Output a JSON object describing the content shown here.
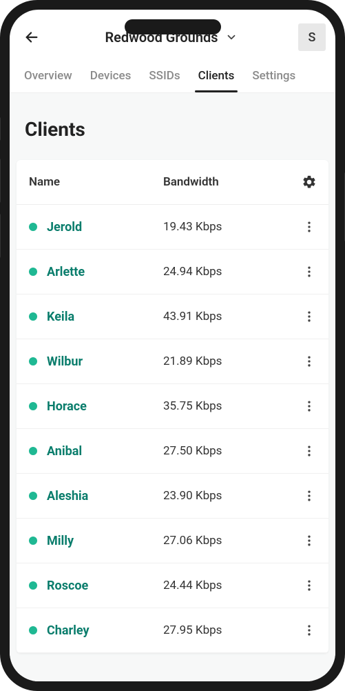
{
  "header": {
    "site_name": "Redwood Grounds",
    "avatar_initial": "S"
  },
  "tabs": [
    {
      "label": "Overview",
      "active": false
    },
    {
      "label": "Devices",
      "active": false
    },
    {
      "label": "SSIDs",
      "active": false
    },
    {
      "label": "Clients",
      "active": true
    },
    {
      "label": "Settings",
      "active": false
    }
  ],
  "page": {
    "title": "Clients"
  },
  "table": {
    "columns": {
      "name": "Name",
      "bandwidth": "Bandwidth"
    },
    "rows": [
      {
        "name": "Jerold",
        "bandwidth": "19.43 Kbps",
        "status": "online"
      },
      {
        "name": "Arlette",
        "bandwidth": "24.94 Kbps",
        "status": "online"
      },
      {
        "name": "Keila",
        "bandwidth": "43.91 Kbps",
        "status": "online"
      },
      {
        "name": "Wilbur",
        "bandwidth": "21.89 Kbps",
        "status": "online"
      },
      {
        "name": "Horace",
        "bandwidth": "35.75 Kbps",
        "status": "online"
      },
      {
        "name": "Anibal",
        "bandwidth": "27.50 Kbps",
        "status": "online"
      },
      {
        "name": "Aleshia",
        "bandwidth": "23.90 Kbps",
        "status": "online"
      },
      {
        "name": "Milly",
        "bandwidth": "27.06 Kbps",
        "status": "online"
      },
      {
        "name": "Roscoe",
        "bandwidth": "24.44 Kbps",
        "status": "online"
      },
      {
        "name": "Charley",
        "bandwidth": "27.95 Kbps",
        "status": "online"
      }
    ]
  },
  "colors": {
    "accent": "#0a7d6c",
    "status_online": "#1fb893"
  }
}
